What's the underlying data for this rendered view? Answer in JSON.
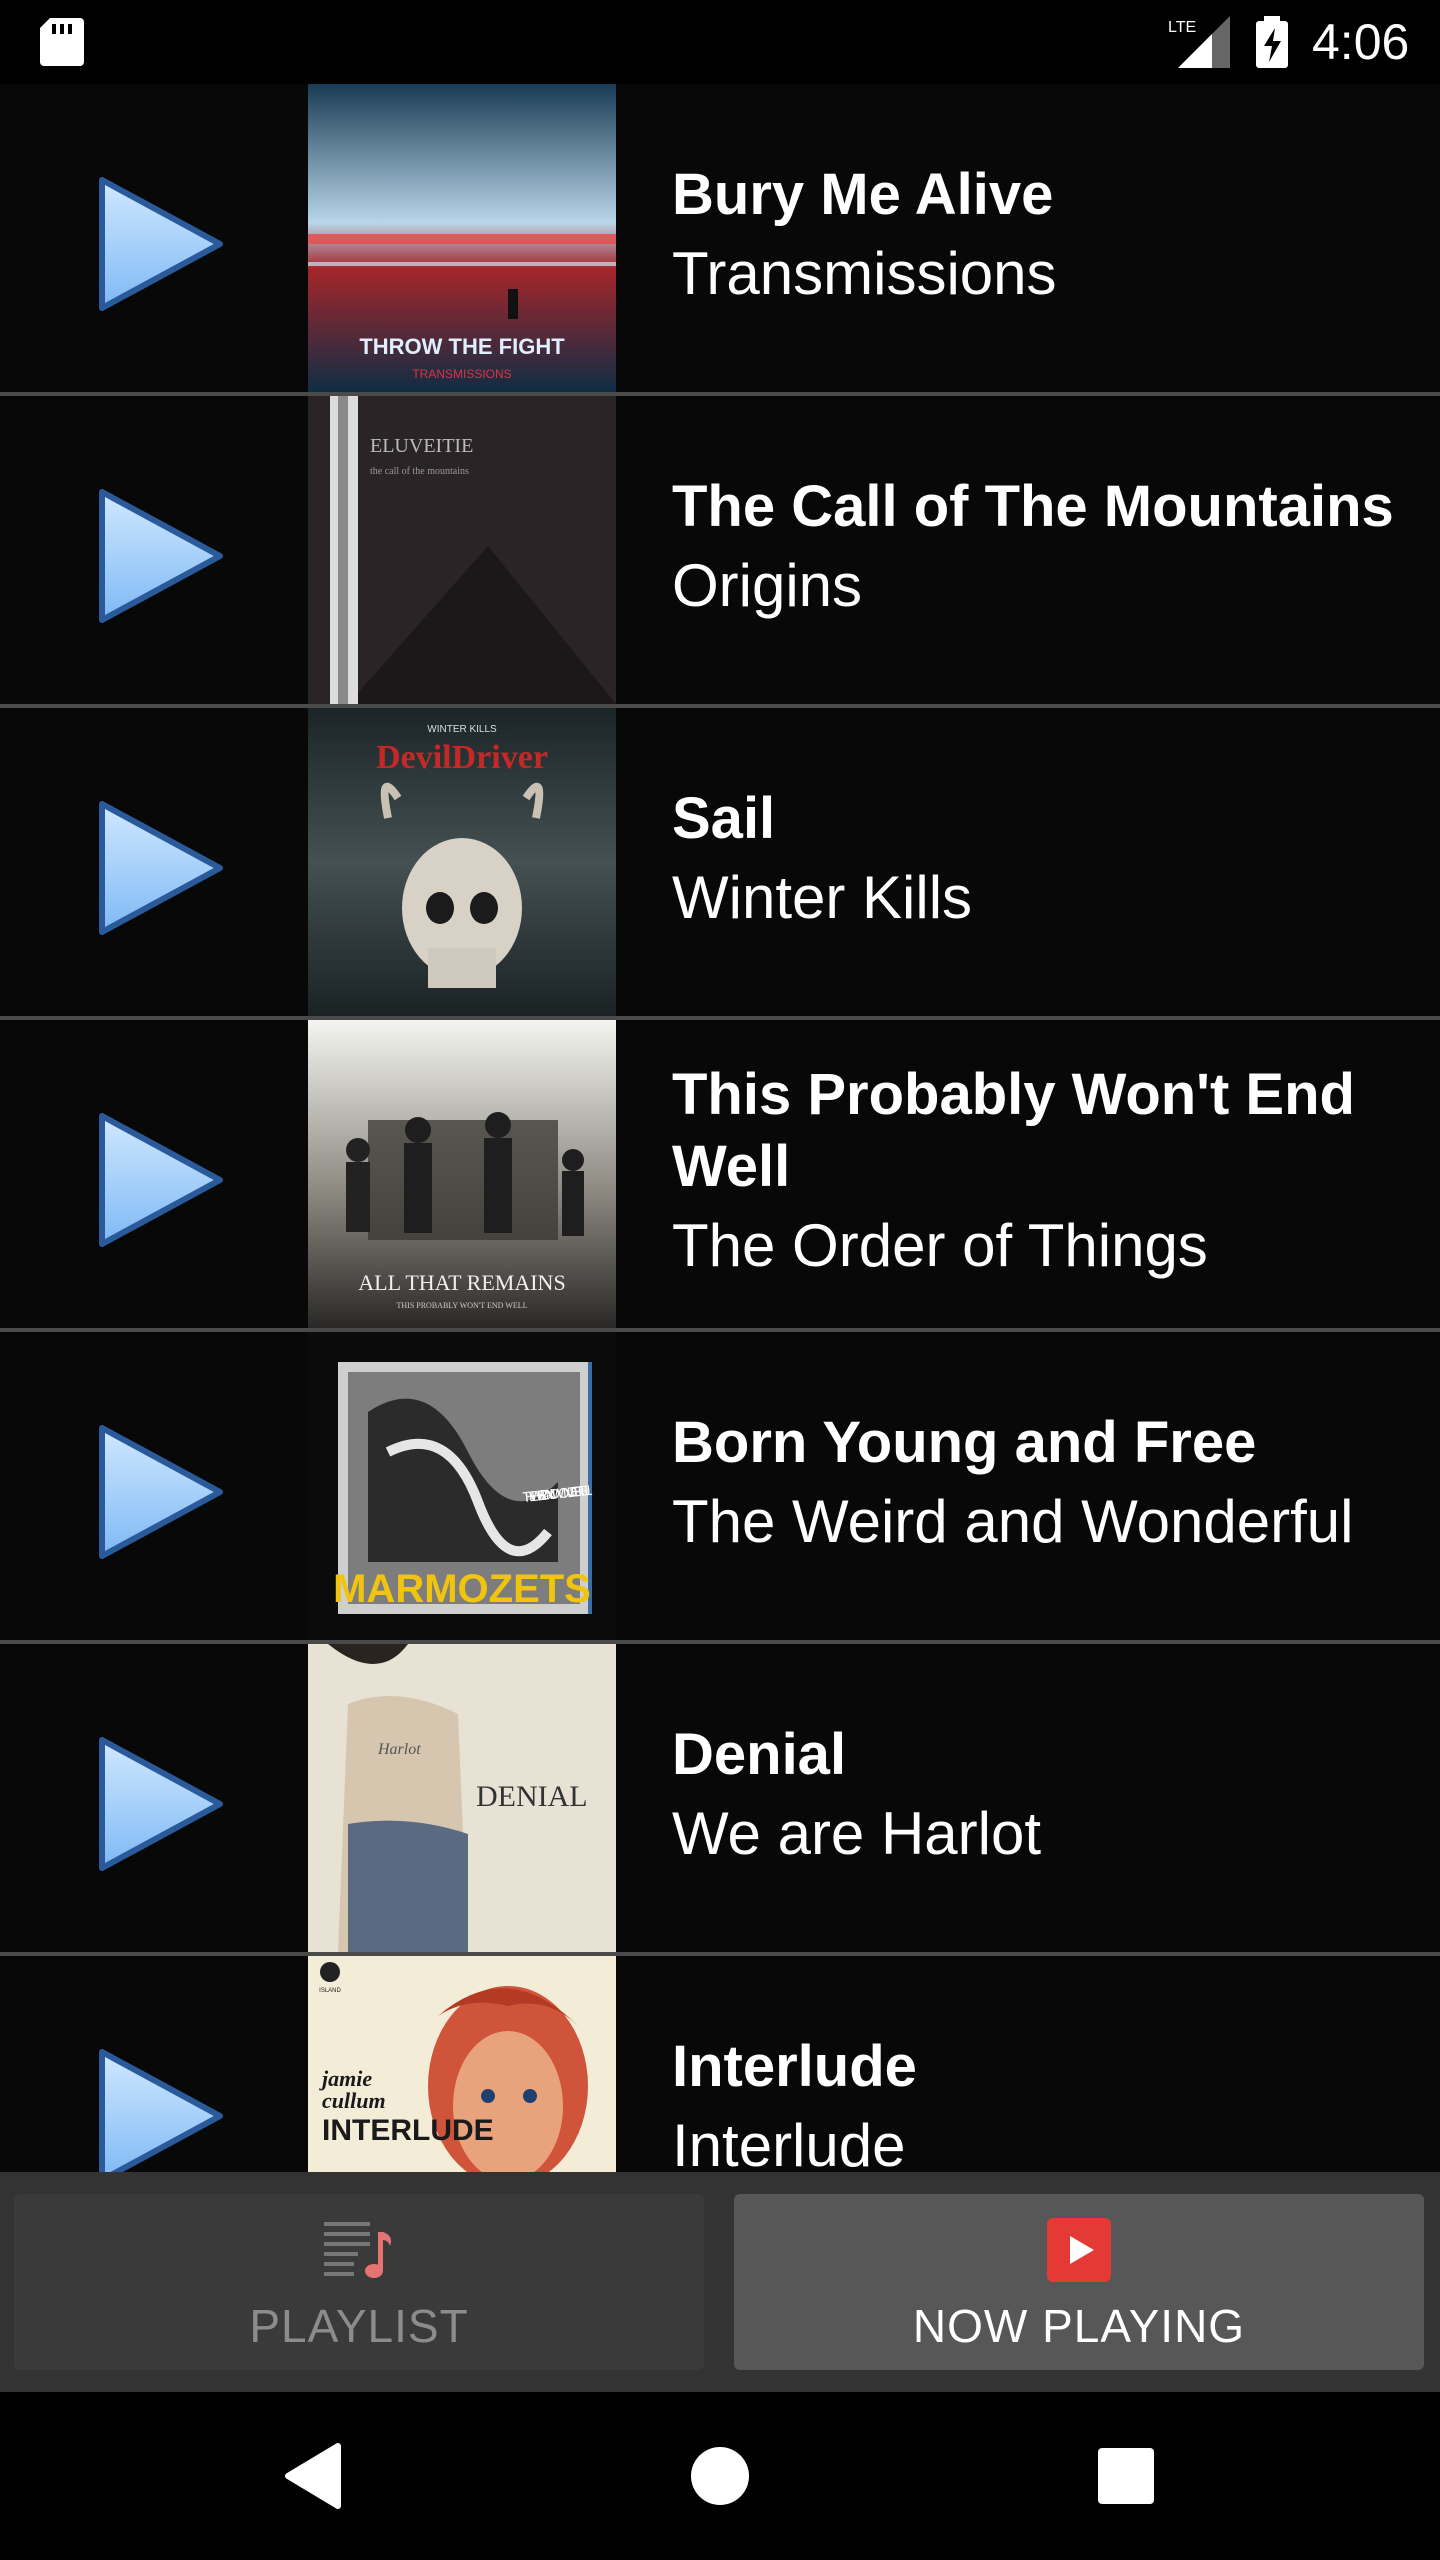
{
  "status_bar": {
    "time": "4:06",
    "network": "LTE",
    "icons": [
      "sd-card-icon",
      "lte-signal-icon",
      "battery-charging-icon"
    ]
  },
  "tracks": [
    {
      "title": "Bury Me Alive",
      "album": "Transmissions",
      "cover_text": [
        "THROW THE FIGHT",
        "TRANSMISSIONS"
      ]
    },
    {
      "title": "The Call of The Mountains",
      "album": "Origins",
      "cover_text": [
        "ELUVEITIE",
        "the call of the mountains"
      ]
    },
    {
      "title": "Sail",
      "album": "Winter Kills",
      "cover_text": [
        "WINTER KILLS",
        "DevilDriver"
      ]
    },
    {
      "title": "This Probably Won't End Well",
      "album": "The Order of Things",
      "cover_text": [
        "ALL THAT REMAINS",
        "THIS PROBABLY WON'T END WELL"
      ]
    },
    {
      "title": "Born Young and Free",
      "album": "The Weird and Wonderful",
      "cover_text": [
        "THE WEIRD AND WONDERFUL",
        "MARMOZETS"
      ]
    },
    {
      "title": "Denial",
      "album": "We are Harlot",
      "cover_text": [
        "DENIAL",
        "Harlot"
      ]
    },
    {
      "title": "Interlude",
      "album": "Interlude",
      "cover_text": [
        "jamie",
        "cullum",
        "INTERLUDE",
        "ISLAND"
      ]
    }
  ],
  "tabs": {
    "playlist": {
      "label": "PLAYLIST",
      "icon": "playlist-music-icon"
    },
    "now_playing": {
      "label": "NOW PLAYING",
      "icon": "play-box-icon",
      "selected": true
    }
  },
  "nav": {
    "icons": [
      "back-icon",
      "home-icon",
      "recents-icon"
    ]
  },
  "colors": {
    "play_button": "#9fcfff",
    "row_divider": "#4a4a4a",
    "now_playing_icon": "#e53935",
    "playlist_icon_accent": "#e57373"
  }
}
